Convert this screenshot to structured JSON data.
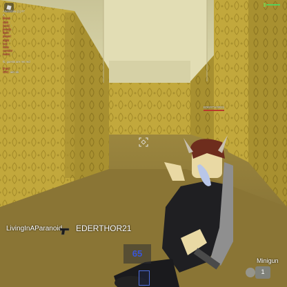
{
  "chat": {
    "lines": [
      {
        "name": "",
        "text": "Ahetroblox [1] #7",
        "sys": true
      },
      {
        "name": "",
        "text": "A",
        "sys": true
      },
      {
        "name": "blood",
        "text": ":"
      },
      {
        "name": "dark",
        "text": ":"
      },
      {
        "name": "[nick]",
        "text": ":"
      },
      {
        "name": "pewds",
        "text": ":"
      },
      {
        "name": "flesh",
        "text": ":"
      },
      {
        "name": "player:",
        "text": ""
      },
      {
        "name": "night",
        "text": ":"
      },
      {
        "name": "run:",
        "text": ""
      },
      {
        "name": "hello",
        "text": ":"
      },
      {
        "name": "corridor",
        "text": ":"
      },
      {
        "name": "name",
        "text": ":"
      },
      {
        "name": "",
        "text": ""
      },
      {
        "name": "",
        "text": "hi, guests are ren red",
        "sys": true
      },
      {
        "name": "",
        "text": ""
      },
      {
        "name": "[Fan]",
        "text": ""
      },
      {
        "name": "XRC",
        "text": "aim ok"
      }
    ]
  },
  "enemy": {
    "name": "EDERTHOR21"
  },
  "players": {
    "left_name": "LivingInAParanoid",
    "right_name": "EDERTHOR21"
  },
  "weapon": {
    "ammo": "65",
    "name": "Minigun",
    "slot": "1"
  },
  "colors": {
    "wall": "#c4aa3e",
    "ceiling": "#d3cfa1",
    "carpet": "#857237",
    "ammo": "#3a55d8",
    "health": "#56d05a"
  },
  "icons": [
    "roblox-menu-icon",
    "crosshair-icon",
    "pistol-icon",
    "health-bar-icon"
  ]
}
